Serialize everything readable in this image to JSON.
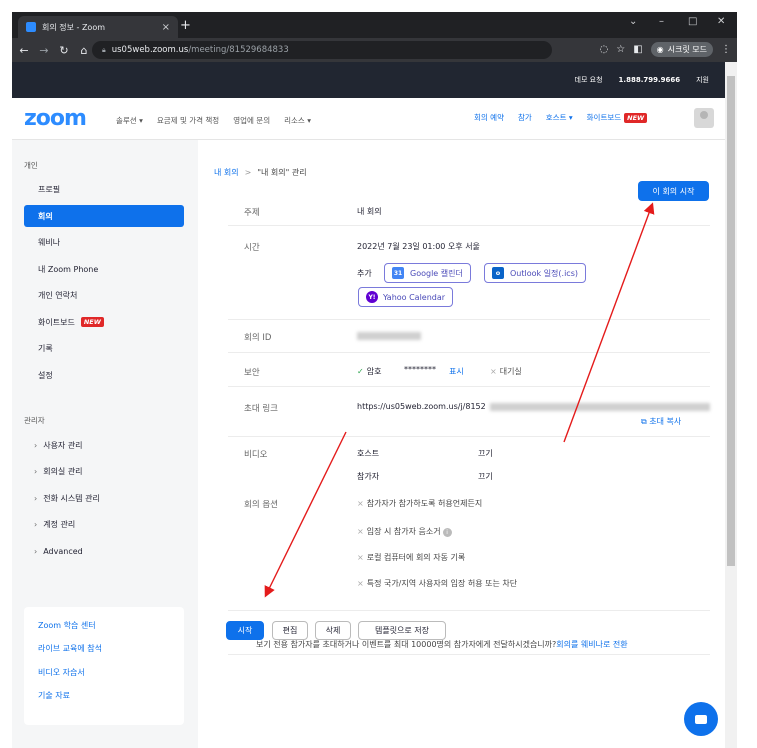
{
  "browser": {
    "tab_title": "회의 정보 - Zoom",
    "tab_close": "×",
    "new_tab": "+",
    "url_host": "us05web.zoom.us",
    "url_path": "/meeting/81529684833",
    "incognito_label": "시크릿 모드",
    "win_min": "–",
    "win_max": "□",
    "win_close": "✕",
    "win_caret": "⌄"
  },
  "util_bar": {
    "demo": "데모 요청",
    "phone": "1.888.799.9666",
    "support": "지원"
  },
  "nav": {
    "logo": "zoom",
    "solutions": "솔루션 ▾",
    "pricing": "요금제 및 가격 책정",
    "sales": "영업에 문의",
    "resources": "리소스 ▾",
    "schedule": "회의 예약",
    "join": "참가",
    "host": "호스트 ▾",
    "whiteboard": "화이트보드",
    "new_badge": "NEW"
  },
  "sidebar": {
    "personal_title": "개인",
    "items": [
      {
        "label": "프로필"
      },
      {
        "label": "회의"
      },
      {
        "label": "웨비나"
      },
      {
        "label": "내 Zoom Phone"
      },
      {
        "label": "개인 연락처"
      },
      {
        "label": "화이트보드"
      },
      {
        "label": "기록"
      },
      {
        "label": "설정"
      }
    ],
    "new_badge": "NEW",
    "admin_title": "관리자",
    "admin_items": [
      {
        "label": "사용자 관리"
      },
      {
        "label": "회의실 관리"
      },
      {
        "label": "전화 시스템 관리"
      },
      {
        "label": "계정 관리"
      },
      {
        "label": "Advanced"
      }
    ],
    "learn": [
      {
        "label": "Zoom 학습 센터"
      },
      {
        "label": "라이브 교육에 참석"
      },
      {
        "label": "비디오 자습서"
      },
      {
        "label": "기술 자료"
      }
    ]
  },
  "main": {
    "crumb_root": "내 회의",
    "crumb_sep": ">",
    "crumb_current": "\"내 회의\" 관리",
    "start_meeting": "이 회의 시작",
    "topic_label": "주제",
    "topic_value": "내 회의",
    "time_label": "시간",
    "time_value": "2022년 7월 23일 01:00 오후 서울",
    "add_label": "추가",
    "google_cal": "Google 캘린더",
    "outlook_cal": "Outlook 일정(.ics)",
    "yahoo_cal": "Yahoo Calendar",
    "id_label": "회의 ID",
    "security_label": "보안",
    "passcode_label": "암호",
    "passcode_mask": "********",
    "show": "표시",
    "waiting_room": "대기실",
    "invite_label": "초대 링크",
    "invite_url": "https://us05web.zoom.us/j/8152",
    "copy_invite": "초대 복사",
    "video_label": "비디오",
    "host_label": "호스트",
    "host_value": "끄기",
    "participant_label": "참가자",
    "participant_value": "끄기",
    "options_label": "회의 옵션",
    "options": [
      "참가자가 참가하도록 허용언제든지",
      "입장 시 참가자 음소거",
      "로컬 컴퓨터에 회의 자동 기록",
      "특정 국가/지역 사용자의 입장 허용 또는 차단"
    ],
    "btn_start": "시작",
    "btn_edit": "편집",
    "btn_delete": "삭제",
    "btn_template": "템플릿으로 저장",
    "webinar_note": "보기 전용 참가자를 초대하거나 이벤트를 최대 10000명의 참가자에게 전달하시겠습니까?",
    "webinar_link": "회의를 웨비나로 전환"
  }
}
